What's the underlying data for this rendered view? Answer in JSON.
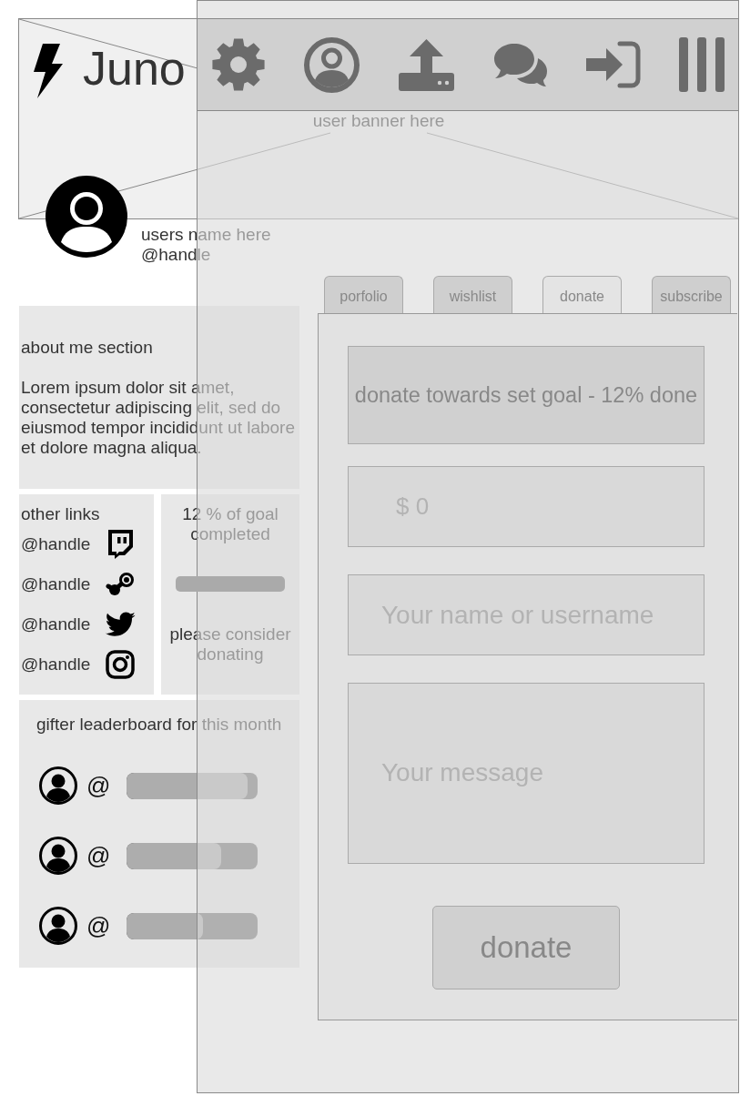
{
  "header": {
    "logo_text": "Juno",
    "toolbar": [
      {
        "kind": "settings"
      },
      {
        "kind": "profile"
      },
      {
        "kind": "upload"
      },
      {
        "kind": "messages"
      },
      {
        "kind": "sign_in"
      },
      {
        "kind": "menu"
      }
    ]
  },
  "banner": {
    "label": "user banner here"
  },
  "profile": {
    "name": "users name here",
    "handle": "@handle"
  },
  "about": {
    "title": "about me section",
    "text": "Lorem ipsum dolor sit amet, consectetur adipiscing elit, sed do eiusmod tempor incididunt ut labore et dolore magna aliqua."
  },
  "other_links": {
    "title": "other links",
    "links": [
      {
        "kind": "twitch",
        "handle": "@handle"
      },
      {
        "kind": "steam",
        "handle": "@handle"
      },
      {
        "kind": "twitter",
        "handle": "@handle"
      },
      {
        "kind": "instagram",
        "handle": "@handle"
      }
    ]
  },
  "goal": {
    "title": "12 % of goal completed",
    "note": "please consider donating"
  },
  "leaderboard": {
    "title": "gifter leaderboard for this month",
    "rows": [
      {
        "handle": "@",
        "level": 0.92
      },
      {
        "handle": "@",
        "level": 0.72
      },
      {
        "handle": "@",
        "level": 0.58
      }
    ]
  },
  "tabs": [
    {
      "label": "porfolio",
      "selected": false
    },
    {
      "label": "wishlist",
      "selected": false
    },
    {
      "label": "donate",
      "selected": true
    },
    {
      "label": "subscribe",
      "selected": false
    }
  ],
  "donate_form": {
    "goal_text": "donate towards set goal - 12% done",
    "amount": {
      "placeholder": "$ 0"
    },
    "name": {
      "placeholder": "Your name or username"
    },
    "message": {
      "placeholder": "Your message"
    },
    "button": "donate"
  }
}
